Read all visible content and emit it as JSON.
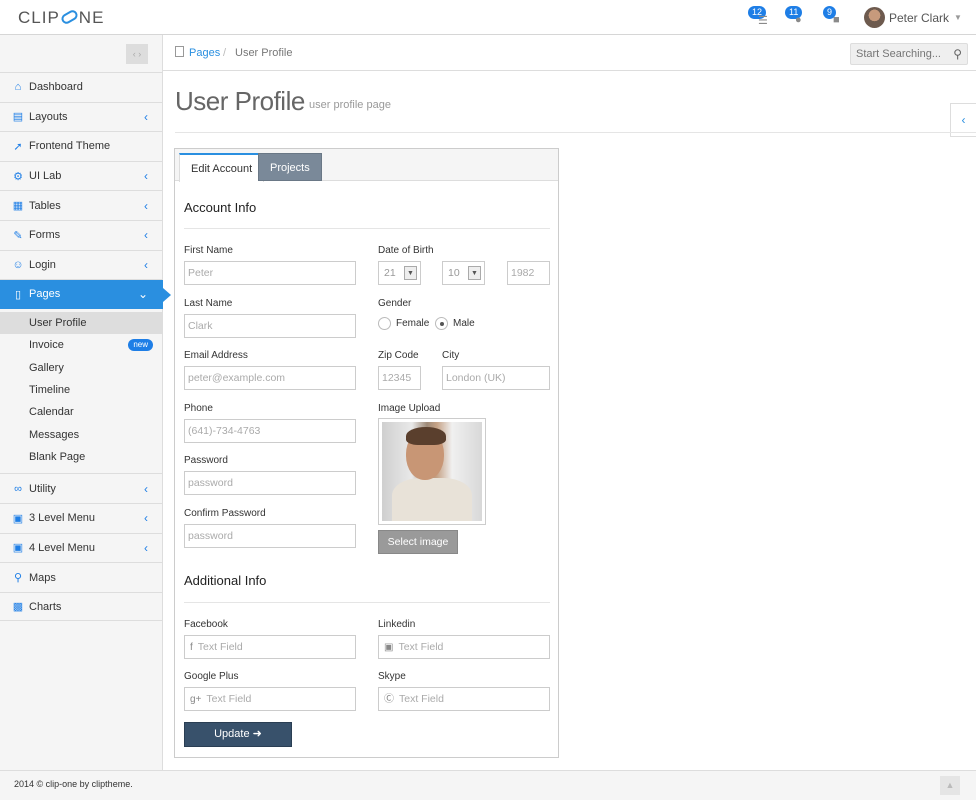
{
  "app": {
    "logo_left": "CLIP",
    "logo_right": "NE"
  },
  "topbar": {
    "notifications": [
      {
        "count": "12",
        "icon": "tasks-icon"
      },
      {
        "count": "11",
        "icon": "alert-icon"
      },
      {
        "count": "9",
        "icon": "chat-icon"
      }
    ],
    "user_name": "Peter Clark"
  },
  "sidebar": {
    "items": [
      {
        "label": "Dashboard",
        "icon": "home-icon"
      },
      {
        "label": "Layouts",
        "icon": "monitor-icon"
      },
      {
        "label": "Frontend Theme",
        "icon": "cursor-icon"
      },
      {
        "label": "UI Lab",
        "icon": "gear-icon"
      },
      {
        "label": "Tables",
        "icon": "table-icon"
      },
      {
        "label": "Forms",
        "icon": "edit-icon"
      },
      {
        "label": "Login",
        "icon": "user-icon"
      },
      {
        "label": "Pages",
        "icon": "page-icon"
      }
    ],
    "sub_items": [
      "User Profile",
      "Invoice",
      "Gallery",
      "Timeline",
      "Calendar",
      "Messages",
      "Blank Page"
    ],
    "new_badge": "new",
    "items_after": [
      {
        "label": "Utility",
        "icon": "link-icon"
      },
      {
        "label": "3 Level Menu",
        "icon": "folder-icon"
      },
      {
        "label": "4 Level Menu",
        "icon": "folder-icon"
      },
      {
        "label": "Maps",
        "icon": "map-pin-icon"
      },
      {
        "label": "Charts",
        "icon": "chart-icon"
      }
    ]
  },
  "breadcrumb": {
    "link": "Pages",
    "separator": "/",
    "current": "User Profile"
  },
  "search": {
    "placeholder": "Start Searching..."
  },
  "page": {
    "title": "User Profile",
    "subtitle": "user profile page"
  },
  "tabs": [
    "Edit Account",
    "Projects"
  ],
  "form": {
    "account_title": "Account Info",
    "first_name_label": "First Name",
    "first_name": "Peter",
    "last_name_label": "Last Name",
    "last_name": "Clark",
    "email_label": "Email Address",
    "email": "peter@example.com",
    "phone_label": "Phone",
    "phone": "(641)-734-4763",
    "password_label": "Password",
    "password": "password",
    "confirm_label": "Confirm Password",
    "confirm": "password",
    "dob_label": "Date of Birth",
    "dob_day": "21",
    "dob_month": "10",
    "dob_year": "1982",
    "gender_label": "Gender",
    "female": "Female",
    "male": "Male",
    "zip_label": "Zip Code",
    "zip": "12345",
    "city_label": "City",
    "city": "London (UK)",
    "image_label": "Image Upload",
    "select_image": "Select image",
    "additional_title": "Additional Info",
    "facebook_label": "Facebook",
    "linkedin_label": "Linkedin",
    "google_label": "Google Plus",
    "skype_label": "Skype",
    "text_field": "Text Field",
    "update": "Update"
  },
  "footer": {
    "text": "2014 © clip-one by cliptheme."
  }
}
